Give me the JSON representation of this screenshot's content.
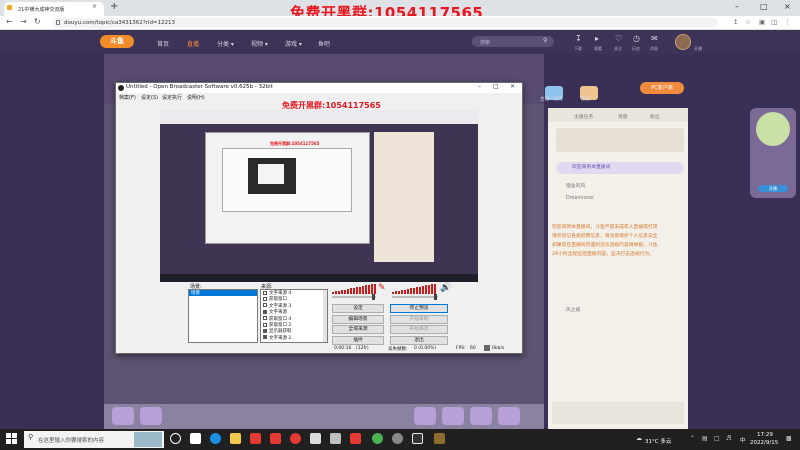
{
  "browser": {
    "tab_title": "21中横大成神交流版",
    "url": "douyu.com/topic/ca3431362?rid=12213",
    "new_tab_glyph": "+",
    "tab_close_glyph": "×",
    "window_buttons": [
      "–",
      "□",
      "×"
    ],
    "nav_icons": [
      "back-icon",
      "forward-icon",
      "reload-icon"
    ],
    "toolbar_icons": [
      "share-icon",
      "star-icon",
      "extensions-icon",
      "sidebar-icon",
      "profile-icon"
    ]
  },
  "promo_text": "免费开黑群:1054117565",
  "site": {
    "logo_text": "斗鱼",
    "nav": [
      "首页",
      "直播",
      "分类 ▾",
      "视频 ▾",
      "游戏 ▾",
      "鱼吧"
    ],
    "active_nav_index": 1,
    "search_placeholder": "搜索",
    "header_icons": [
      "下载",
      "观看",
      "关注",
      "历史",
      "消息",
      "开播"
    ],
    "pk_badge": "PC客户端"
  },
  "obs": {
    "title": "Untitled - Open Broadcaster Software v0.625b - 32bit",
    "menu": [
      "档案(F)",
      "设定(S)",
      "设定执行",
      "说明(H)"
    ],
    "scenes_label": "场景:",
    "sources_label": "来源:",
    "selected_scene": "场景",
    "sources": [
      {
        "label": "文字来源 4",
        "checked": false
      },
      {
        "label": "获取窗口",
        "checked": false
      },
      {
        "label": "文字来源 3",
        "checked": false
      },
      {
        "label": "文字来源",
        "checked": true
      },
      {
        "label": "获取窗口 4",
        "checked": false
      },
      {
        "label": "获取窗口 2",
        "checked": false
      },
      {
        "label": "显示器获取",
        "checked": true
      },
      {
        "label": "文字来源 2",
        "checked": true
      }
    ],
    "buttons": {
      "settings": "设定",
      "stop_preview": "停止预览",
      "edit_scene": "编辑场景",
      "start_recording": "开始录制",
      "global_sources": "全域来源",
      "plugins": "插件",
      "exit": "退出",
      "disabled_1": "开始录制",
      "disabled_2": "开始串流"
    },
    "status": {
      "time": "0:00:16",
      "fps_box": "(12fr)",
      "dropped_label": "丢失帧数:",
      "dropped_value": "0 (0.00%)",
      "fps_label": "FPS:",
      "fps_value": "60",
      "kbps": "0kb/s"
    }
  },
  "page": {
    "right_panel": {
      "tabs": [
        "主播任务",
        "贡献",
        "粉丝"
      ],
      "welcome": "欢迎来到本直播间",
      "messages": [
        "欢迎来到本直播间，斗鱼严禁未成年人直播或打赏",
        "请勿轻信各类招聘信息，请注意保护个人信息安全",
        "如果您在直播间内遇到违法违规内容请举报，斗鱼",
        "24小时全程监控直播内容，坚决打击违规行为。"
      ],
      "chat_users": [
        "宿舍的风",
        "Dreamlover",
        "风之痕"
      ]
    },
    "user_ids": [
      "用户",
      "主播一起玩",
      "数据",
      "赚取"
    ]
  },
  "taskbar": {
    "search_placeholder": "在这里输入你要搜索的内容",
    "weather": "31°C 多云",
    "time": "17:29",
    "date": "2022/9/15",
    "lang": "中"
  }
}
